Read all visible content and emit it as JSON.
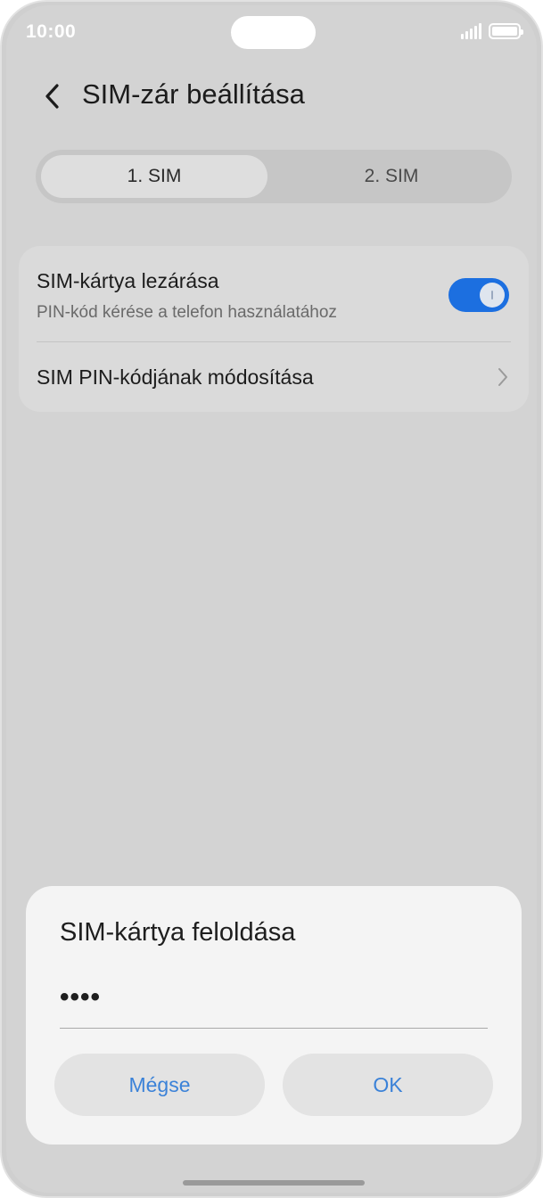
{
  "status_bar": {
    "time": "10:00",
    "icons": [
      "signal-icon",
      "battery-icon"
    ]
  },
  "header": {
    "back_icon": "chevron-left-icon",
    "title": "SIM-zár beállítása"
  },
  "sim_tabs": [
    {
      "label": "1. SIM",
      "selected": true
    },
    {
      "label": "2. SIM",
      "selected": false
    }
  ],
  "settings": {
    "lock_sim": {
      "title": "SIM-kártya lezárása",
      "subtitle": "PIN-kód kérése a telefon használatához",
      "enabled": true
    },
    "change_pin": {
      "title": "SIM PIN-kódjának módosítása",
      "icon": "chevron-right-icon"
    }
  },
  "dialog": {
    "title": "SIM-kártya feloldása",
    "pin_value": "••••",
    "cancel_label": "Mégse",
    "ok_label": "OK"
  },
  "colors": {
    "accent": "#1c6fe0",
    "dialog_button_text": "#3b82d8"
  }
}
